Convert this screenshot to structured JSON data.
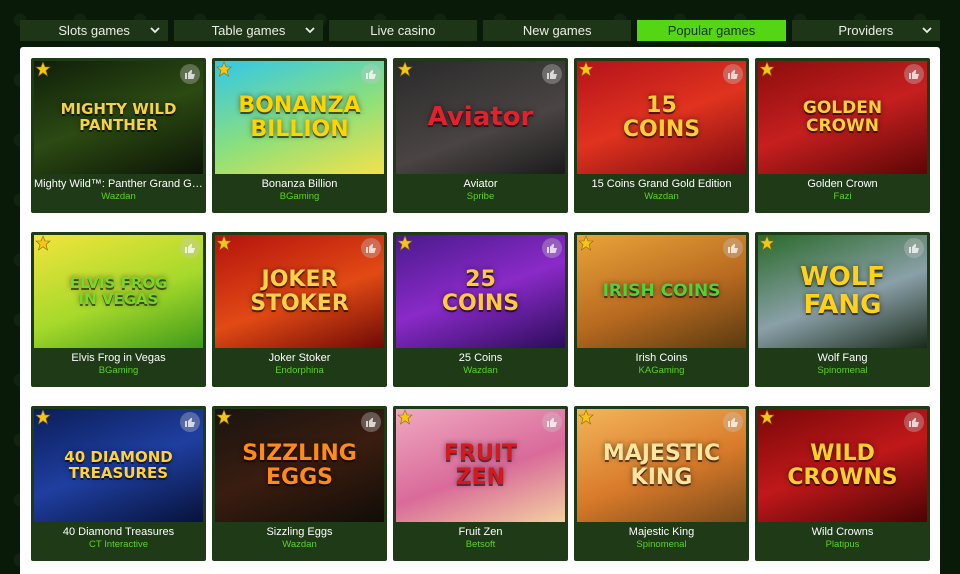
{
  "tabs": [
    {
      "label": "Slots games",
      "dropdown": true,
      "active": false
    },
    {
      "label": "Table games",
      "dropdown": true,
      "active": false
    },
    {
      "label": "Live casino",
      "dropdown": false,
      "active": false
    },
    {
      "label": "New games",
      "dropdown": false,
      "active": false
    },
    {
      "label": "Popular games",
      "dropdown": false,
      "active": true
    },
    {
      "label": "Providers",
      "dropdown": true,
      "active": false
    }
  ],
  "colors": {
    "accent": "#55d615",
    "card_bg": "#1f3a17",
    "provider_text": "#5cd31f",
    "star": "#f5c518"
  },
  "games": [
    {
      "name": "Mighty Wild™: Panther Grand Gold Edition",
      "provider": "Wazdan",
      "art": "MIGHTY WILD\nPANTHER",
      "bg": "linear-gradient(160deg,#0f1f0a,#2c4a12 50%,#0b1406)",
      "fg": "#f3d24a"
    },
    {
      "name": "Bonanza Billion",
      "provider": "BGaming",
      "art": "BONANZA\nBILLION",
      "bg": "linear-gradient(160deg,#33c7e8,#8ee07a 55%,#f4e14a)",
      "fg": "#ffd400"
    },
    {
      "name": "Aviator",
      "provider": "Spribe",
      "art": "Aviator",
      "bg": "linear-gradient(160deg,#2a2a2a,#4a4444 60%,#1b1b1b)",
      "fg": "#e3202e"
    },
    {
      "name": "15 Coins Grand Gold Edition",
      "provider": "Wazdan",
      "art": "15\nCOINS",
      "bg": "linear-gradient(160deg,#b5121b,#e0331f 50%,#7a0a10)",
      "fg": "#ffcc3a"
    },
    {
      "name": "Golden Crown",
      "provider": "Fazi",
      "art": "GOLDEN CROWN",
      "bg": "linear-gradient(160deg,#8c0d0d,#c61f1f 50%,#5b0606)",
      "fg": "#ffcf40"
    },
    {
      "name": "Elvis Frog in Vegas",
      "provider": "BGaming",
      "art": "ELVIS FROG\nIN VEGAS",
      "bg": "linear-gradient(160deg,#f2e43c,#a6d92b 55%,#3e9a1a)",
      "fg": "#7ad62a"
    },
    {
      "name": "Joker Stoker",
      "provider": "Endorphina",
      "art": "JOKER\nSTOKER",
      "bg": "linear-gradient(160deg,#b3130d,#e24a14 55%,#6d0a06)",
      "fg": "#ffd14a"
    },
    {
      "name": "25 Coins",
      "provider": "Wazdan",
      "art": "25\nCOINS",
      "bg": "linear-gradient(160deg,#4a1a8c,#8a2ac8 50%,#2b0d5a)",
      "fg": "#ffc93a"
    },
    {
      "name": "Irish Coins",
      "provider": "KAGaming",
      "art": "IRISH COINS",
      "bg": "linear-gradient(160deg,#e9a43a,#b86a20 55%,#5a3a10)",
      "fg": "#4fd23a"
    },
    {
      "name": "Wolf Fang",
      "provider": "Spinomenal",
      "art": "WOLF FANG",
      "bg": "linear-gradient(160deg,#2a6a2a,#8aa0a8 55%,#1a2a1a)",
      "fg": "#ffd21a"
    },
    {
      "name": "40 Diamond Treasures",
      "provider": "CT Interactive",
      "art": "40 DIAMOND\nTREASURES",
      "bg": "linear-gradient(160deg,#0b1e5a,#1f3fa0 50%,#07123a)",
      "fg": "#ffd23a"
    },
    {
      "name": "Sizzling Eggs",
      "provider": "Wazdan",
      "art": "SIZZLING\nEGGS",
      "bg": "linear-gradient(160deg,#1a1410,#3a1d10 50%,#120c08)",
      "fg": "#ff8a1a"
    },
    {
      "name": "Fruit Zen",
      "provider": "Betsoft",
      "art": "FRUIT\nZEN",
      "bg": "linear-gradient(160deg,#f0a8c0,#d96a9a 55%,#f3d0a0)",
      "fg": "#d6191f"
    },
    {
      "name": "Majestic King",
      "provider": "Spinomenal",
      "art": "MAJESTIC\nKING",
      "bg": "linear-gradient(160deg,#f3b55a,#d87a2a 55%,#7a4a1a)",
      "fg": "#ffe6a0"
    },
    {
      "name": "Wild Crowns",
      "provider": "Platipus",
      "art": "WILD\nCROWNS",
      "bg": "linear-gradient(160deg,#7a0808,#c0181a 50%,#4a0404)",
      "fg": "#ffcf30"
    }
  ]
}
